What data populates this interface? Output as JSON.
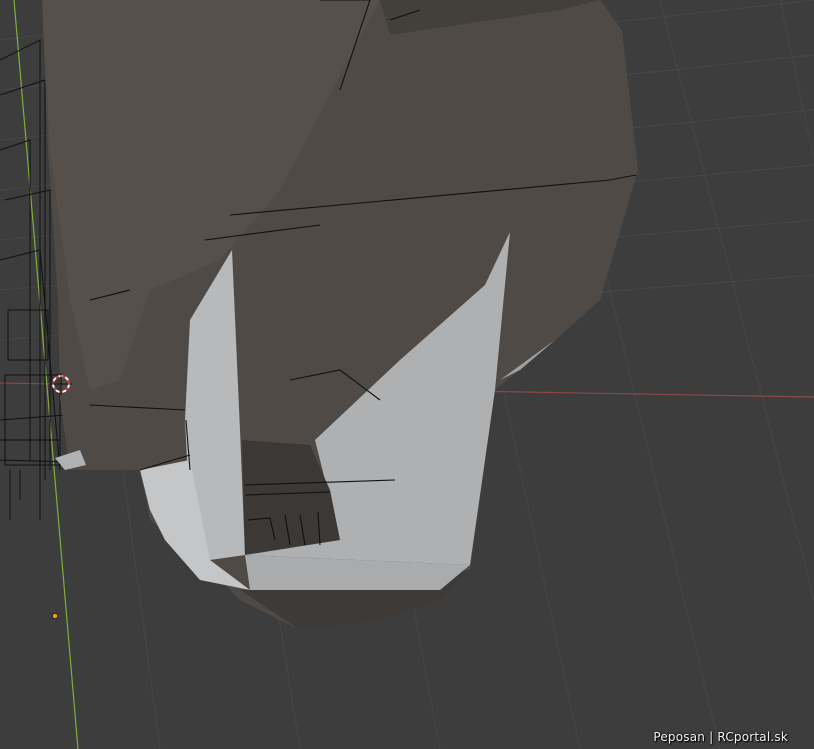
{
  "viewport": {
    "background_color": "#3d3d3d",
    "grid_color": "#4a4a4a",
    "x_axis_color": "#9a4b4b",
    "y_axis_color": "#7fae3a",
    "object_color": "#514c48",
    "highlight_color": "#b7b9bb",
    "origin_marker_color": "#ff9a1a"
  },
  "watermark": {
    "text": "Peposan | RCportal.sk"
  },
  "icons": {
    "cursor": "3d-cursor-icon",
    "origin": "object-origin-icon"
  }
}
